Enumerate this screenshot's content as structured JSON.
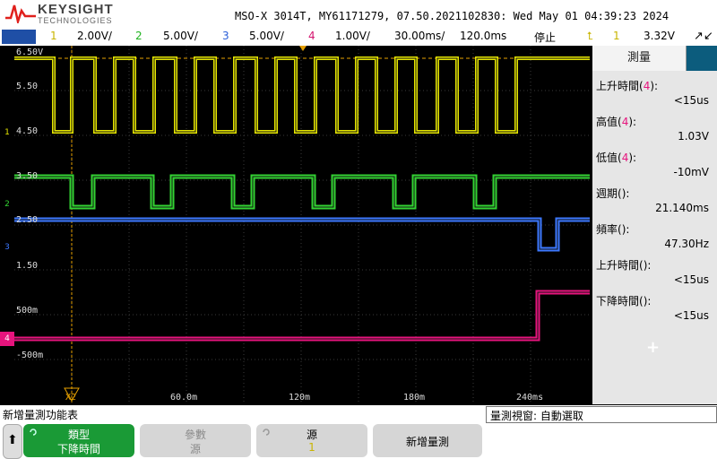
{
  "header": {
    "brand": "KEYSIGHT",
    "brand_sub": "TECHNOLOGIES",
    "instrument": "MSO-X 3014T, MY61171279, 07.50.2021102830: Wed May 01 04:39:23 2024"
  },
  "channel_bar": {
    "ch1_num": "1",
    "ch1_scale": "2.00V/",
    "ch2_num": "2",
    "ch2_scale": "5.00V/",
    "ch3_num": "3",
    "ch3_scale": "5.00V/",
    "ch4_num": "4",
    "ch4_scale": "1.00V/",
    "timebase": "30.00ms/",
    "delay": "120.0ms",
    "run_state": "停止",
    "trigger_source": "1",
    "trigger_level": "3.32V"
  },
  "grid": {
    "levels": [
      "6.50V",
      "5.50",
      "4.50",
      "3.50",
      "2.50",
      "1.50",
      "500m",
      "-500m"
    ],
    "time_labels": [
      "X2",
      "60.0m",
      "120m",
      "180m",
      "240ms"
    ],
    "channel_markers": [
      "1",
      "2",
      "3",
      "4"
    ]
  },
  "colors": {
    "ch1": "#e6e600",
    "ch2": "#32d232",
    "ch3": "#3c78ff",
    "ch4": "#e6147d",
    "cursor": "#e6a000"
  },
  "side_panel": {
    "tab_label": "測量",
    "measurements": [
      {
        "name": "上升時間",
        "src": "4",
        "src_color": "#e6147d",
        "value": "<15us"
      },
      {
        "name": "高值",
        "src": "4",
        "src_color": "#e6147d",
        "value": "1.03V"
      },
      {
        "name": "低值",
        "src": "4",
        "src_color": "#e6147d",
        "value": "-10mV"
      },
      {
        "name": "週期",
        "src": "",
        "src_color": "#c8b400",
        "value": "21.140ms"
      },
      {
        "name": "頻率",
        "src": "",
        "src_color": "#c8b400",
        "value": "47.30Hz"
      },
      {
        "name": "上升時間",
        "src": "",
        "src_color": "#c8b400",
        "value": "<15us"
      },
      {
        "name": "下降時間",
        "src": "",
        "src_color": "#c8b400",
        "value": "<15us"
      }
    ],
    "add_icon": "+"
  },
  "bottom": {
    "menu_title": "新增量測功能表",
    "mode_label": "量測視窗: 自動選取",
    "softkeys": [
      {
        "line1": "類型",
        "line2": "下降時間"
      },
      {
        "line1": "參數",
        "line2": "源"
      },
      {
        "line1": "源",
        "line2": "1"
      },
      {
        "line1": "新增量測",
        "line2": ""
      }
    ]
  }
}
